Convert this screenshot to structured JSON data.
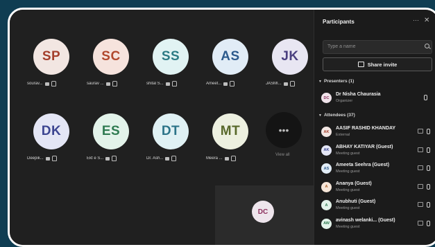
{
  "grid": {
    "tiles": [
      {
        "initials": "SP",
        "name": "sourav...",
        "bg": "#f2e6e2",
        "fg": "#a43f2c"
      },
      {
        "initials": "SC",
        "name": "saurav ...",
        "bg": "#f6e3dd",
        "fg": "#b1492e"
      },
      {
        "initials": "SS",
        "name": "shital S...",
        "bg": "#e1f3f3",
        "fg": "#2d7b85"
      },
      {
        "initials": "AS",
        "name": "Ameet...",
        "bg": "#e1ecf6",
        "fg": "#2c5a8c"
      },
      {
        "initials": "JK",
        "name": "JASMI...",
        "bg": "#e8e6f2",
        "fg": "#4a4080"
      },
      {
        "initials": "DK",
        "name": "Deepik...",
        "bg": "#e4e6f5",
        "fg": "#3c4591"
      },
      {
        "initials": "ES",
        "name": "Ekt e S...",
        "bg": "#e3f3ea",
        "fg": "#2e7a50"
      },
      {
        "initials": "DT",
        "name": "Dr. Ash...",
        "bg": "#e0f1f4",
        "fg": "#2c7489"
      },
      {
        "initials": "MT",
        "name": "Meera ...",
        "bg": "#edf0e0",
        "fg": "#58682a"
      }
    ],
    "view_all": {
      "label": "View all",
      "icon": "ellipsis-icon"
    },
    "self_view": {
      "initials": "DC"
    }
  },
  "panel": {
    "title": "Participants",
    "search_placeholder": "Type a name",
    "share_label": "Share invite",
    "presenters_label": "Presenters (1)",
    "attendees_label": "Attendees (37)",
    "presenters": [
      {
        "initials": "DC",
        "name": "Dr Nisha Chaurasia",
        "role": "Organizer",
        "bg": "#f0e3ea",
        "fg": "#8c2f5c"
      }
    ],
    "attendees": [
      {
        "initials": "AK",
        "name": "AASIF RASHID KHANDAY",
        "role": "External",
        "bg": "#f2e6e2",
        "fg": "#a43f2c"
      },
      {
        "initials": "AK",
        "name": "ABHAY KATIYAR (Guest)",
        "role": "Meeting guest",
        "bg": "#e4e6f5",
        "fg": "#3c4591"
      },
      {
        "initials": "AS",
        "name": "Ameeta Seehra (Guest)",
        "role": "Meeting guest",
        "bg": "#e1ecf6",
        "fg": "#2c5a8c"
      },
      {
        "initials": "A",
        "name": "Ananya (Guest)",
        "role": "Meeting guest",
        "bg": "#f6e6d8",
        "fg": "#a4561c"
      },
      {
        "initials": "A",
        "name": "Anubhuti (Guest)",
        "role": "Meeting guest",
        "bg": "#e3f3ea",
        "fg": "#2e7a50"
      },
      {
        "initials": "AW",
        "name": "avinash welanki...   (Guest)",
        "role": "Meeting guest",
        "bg": "#e3f3ea",
        "fg": "#2e7a50"
      }
    ]
  }
}
